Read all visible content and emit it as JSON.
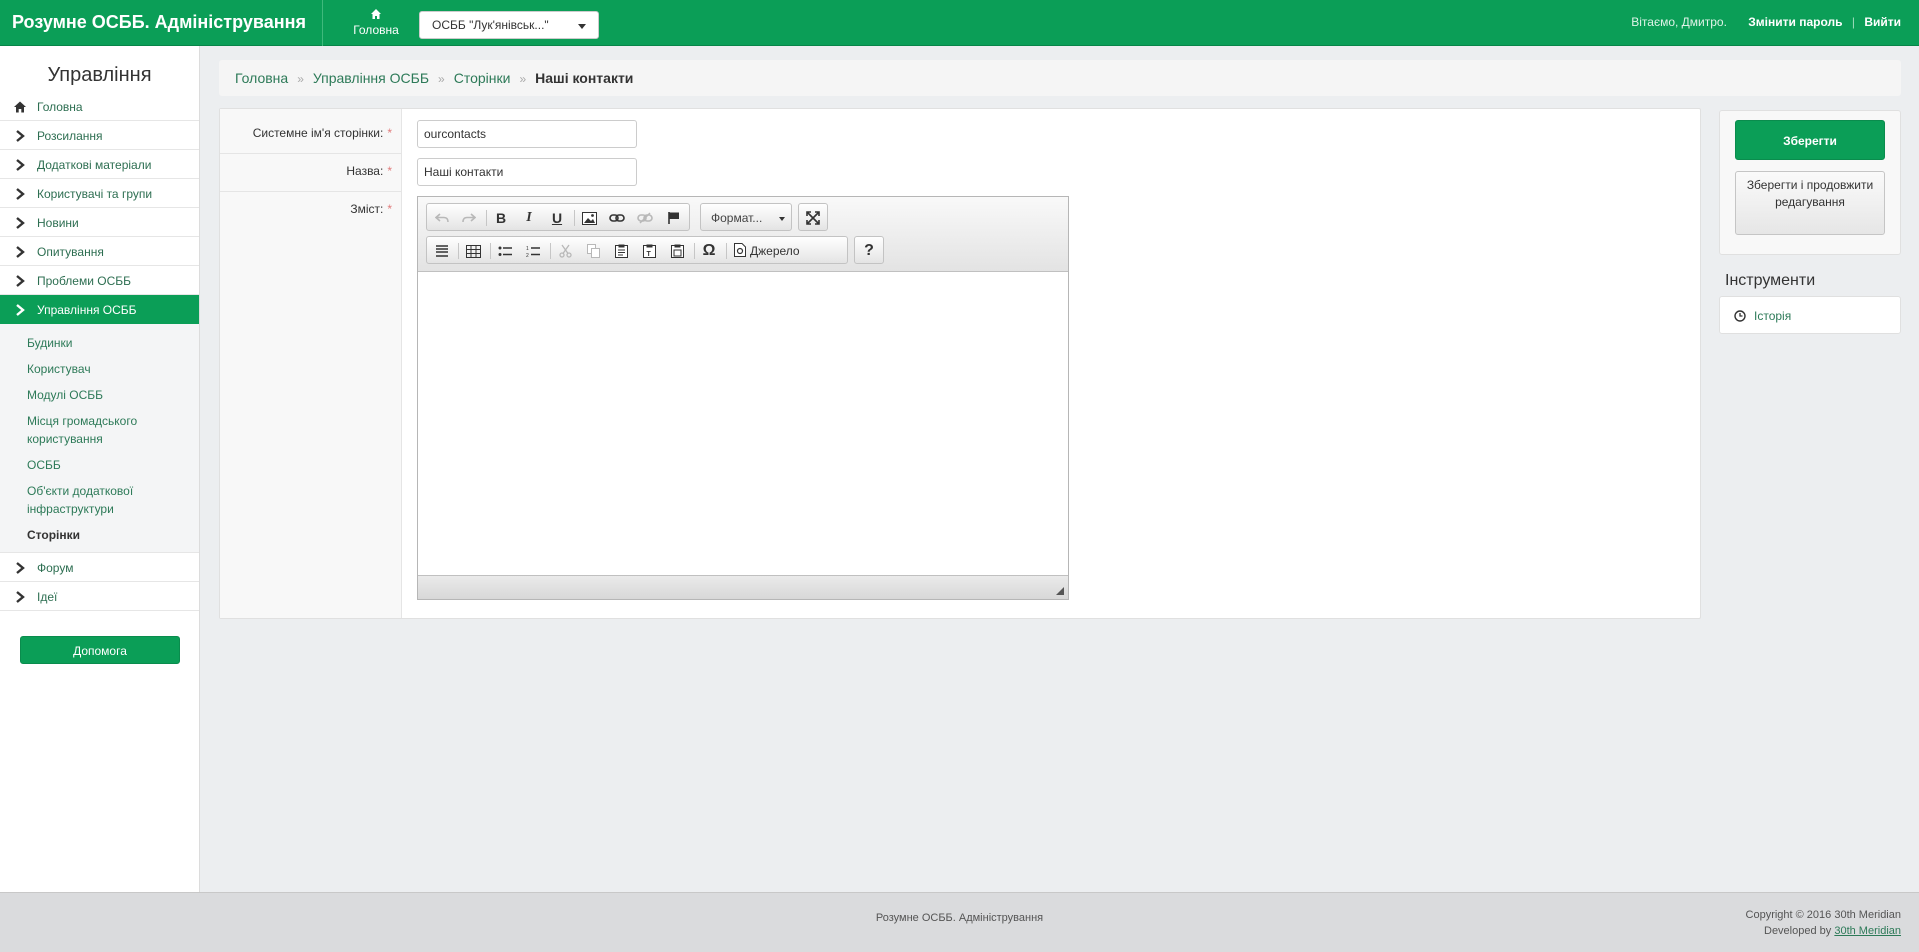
{
  "header": {
    "brand": "Розумне ОСББ. Адміністрування",
    "home_label": "Головна",
    "osbb_select_value": "ОСББ \"Лук'янівськ...\"",
    "greeting": "Вітаємо, Дмитро.",
    "change_password": "Змінити пароль",
    "pipe": "|",
    "logout": "Вийти",
    "brand_color": "#0b9e57"
  },
  "sidebar": {
    "title": "Управління",
    "items": [
      {
        "label": "Головна",
        "icon": "home-icon"
      },
      {
        "label": "Розсилання",
        "icon": "chevron-right-icon"
      },
      {
        "label": "Додаткові матеріали",
        "icon": "chevron-right-icon"
      },
      {
        "label": "Користувачі та групи",
        "icon": "chevron-right-icon"
      },
      {
        "label": "Новини",
        "icon": "chevron-right-icon"
      },
      {
        "label": "Опитування",
        "icon": "chevron-right-icon"
      },
      {
        "label": "Проблеми ОСББ",
        "icon": "chevron-right-icon"
      },
      {
        "label": "Управління ОСББ",
        "icon": "chevron-right-icon",
        "active": true
      }
    ],
    "subitems": [
      {
        "label": "Будинки"
      },
      {
        "label": "Користувач"
      },
      {
        "label": "Модулі ОСББ"
      },
      {
        "label": "Місця громадського користування"
      },
      {
        "label": "ОСББ"
      },
      {
        "label": "Об'єкти додаткової інфраструктури"
      },
      {
        "label": "Сторінки",
        "current": true
      }
    ],
    "items_after": [
      {
        "label": "Форум",
        "icon": "chevron-right-icon"
      },
      {
        "label": "Ідеї",
        "icon": "chevron-right-icon"
      }
    ],
    "help_button": "Допомога"
  },
  "breadcrumb": {
    "items": [
      "Головна",
      "Управління ОСББ",
      "Сторінки"
    ],
    "separator": "»",
    "current": "Наші контакти"
  },
  "form": {
    "system_name_label": "Системне ім'я сторінки:",
    "system_name_value": "ourcontacts",
    "title_label": "Назва:",
    "title_value": "Наші контакти",
    "content_label": "Зміст:",
    "required_mark": "*",
    "editor": {
      "format_combo": "Формат...",
      "source_button": "Джерело",
      "help_glyph": "?",
      "special_char_glyph": "Ω"
    }
  },
  "actions": {
    "save": "Зберегти",
    "save_continue": "Зберегти і продовжити редагування"
  },
  "tools": {
    "title": "Інструменти",
    "history": "Історія"
  },
  "footer": {
    "center": "Розумне ОСББ. Адміністрування",
    "copyright": "Copyright © 2016 30th Meridian",
    "developed_by": "Developed by",
    "developer_link": "30th Meridian"
  }
}
